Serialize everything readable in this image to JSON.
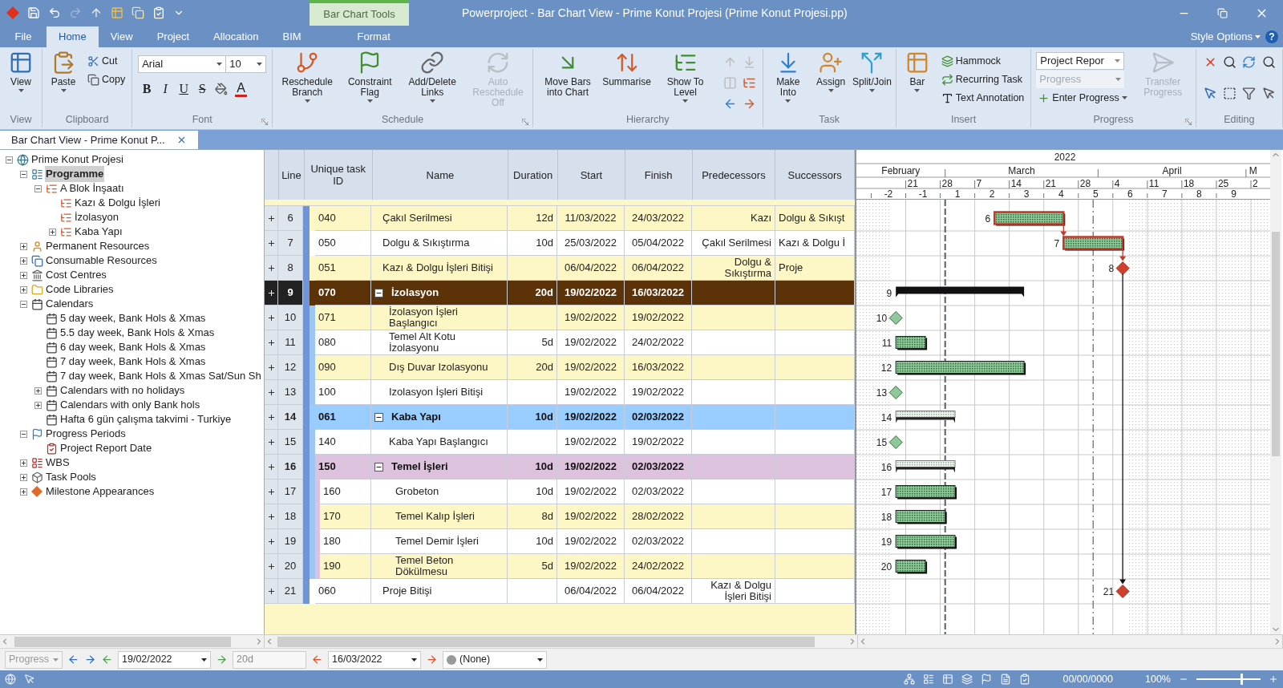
{
  "window": {
    "title": "Powerproject - Bar Chart View - Prime Konut Projesi (Prime Konut Projesi.pp)",
    "context_tab_group": "Bar Chart Tools"
  },
  "ribbon": {
    "file": "File",
    "style_options": "Style Options",
    "help": "?",
    "tabs": [
      {
        "label": "Home",
        "selected": true
      },
      {
        "label": "View",
        "selected": false
      },
      {
        "label": "Project",
        "selected": false
      },
      {
        "label": "Allocation",
        "selected": false
      },
      {
        "label": "BIM",
        "selected": false
      },
      {
        "label": "Format",
        "selected": false
      }
    ],
    "groups": [
      {
        "label": "View",
        "launcher": false,
        "items": [
          {
            "kind": "large",
            "label": "View",
            "dropdown": true,
            "disabled": false
          }
        ]
      },
      {
        "label": "Clipboard",
        "launcher": false,
        "items": [
          {
            "kind": "large",
            "label": "Paste",
            "dropdown": true,
            "disabled": false
          },
          {
            "kind": "small",
            "label": "Cut",
            "dropdown": false,
            "disabled": false
          },
          {
            "kind": "small",
            "label": "Copy",
            "dropdown": false,
            "disabled": false
          }
        ]
      },
      {
        "label": "Font",
        "launcher": true,
        "items": [
          {
            "kind": "font",
            "font": "Arial",
            "size": "10",
            "styles": [
              "B",
              "I",
              "U",
              "S"
            ],
            "color_letter": "A"
          }
        ]
      },
      {
        "label": "Schedule",
        "launcher": true,
        "items": [
          {
            "kind": "large",
            "label": "Reschedule Branch",
            "dropdown": true,
            "disabled": false
          },
          {
            "kind": "large",
            "label": "Constraint Flag",
            "dropdown": true,
            "disabled": false
          },
          {
            "kind": "large",
            "label": "Add/Delete Links",
            "dropdown": true,
            "disabled": false
          },
          {
            "kind": "large",
            "label": "Auto Reschedule Off",
            "dropdown": false,
            "disabled": true
          }
        ]
      },
      {
        "label": "Hierarchy",
        "launcher": false,
        "items": [
          {
            "kind": "large",
            "label": "Move Bars into Chart",
            "dropdown": false,
            "disabled": false
          },
          {
            "kind": "large",
            "label": "Summarise",
            "dropdown": false,
            "disabled": false
          },
          {
            "kind": "large",
            "label": "Show To Level",
            "dropdown": true,
            "disabled": false
          },
          {
            "kind": "icon_grid"
          }
        ]
      },
      {
        "label": "Task",
        "launcher": false,
        "items": [
          {
            "kind": "large",
            "label": "Make Into",
            "dropdown": true,
            "disabled": false
          },
          {
            "kind": "large",
            "label": "Assign",
            "dropdown": true,
            "disabled": false
          },
          {
            "kind": "large",
            "label": "Split/Join",
            "dropdown": true,
            "disabled": false
          }
        ]
      },
      {
        "label": "Insert",
        "launcher": false,
        "items": [
          {
            "kind": "large",
            "label": "Bar",
            "dropdown": true,
            "disabled": false
          },
          {
            "kind": "small",
            "label": "Hammock",
            "dropdown": false,
            "disabled": false
          },
          {
            "kind": "small",
            "label": "Recurring Task",
            "dropdown": false,
            "disabled": false
          },
          {
            "kind": "small",
            "label": "Text Annotation",
            "dropdown": false,
            "disabled": false
          }
        ]
      },
      {
        "label": "Progress",
        "launcher": true,
        "items": [
          {
            "kind": "combo",
            "value": "Project Repor",
            "disabled": false
          },
          {
            "kind": "combo",
            "value": "Progress",
            "disabled": true
          },
          {
            "kind": "small",
            "label": "Enter Progress",
            "dropdown": true,
            "disabled": false
          },
          {
            "kind": "large",
            "label": "Transfer Progress",
            "dropdown": false,
            "disabled": true
          }
        ]
      },
      {
        "label": "Editing",
        "launcher": false,
        "items": [
          {
            "kind": "icon_grid"
          }
        ]
      }
    ]
  },
  "document_tab": {
    "label": "Bar Chart View - Prime Konut P...",
    "selected": true
  },
  "tree": [
    {
      "label": "Prime Konut Projesi",
      "kind": "project",
      "expanded": true,
      "selected": false,
      "children": [
        {
          "label": "Programme",
          "kind": "programme",
          "expanded": true,
          "selected": true,
          "children": [
            {
              "label": "A Blok İnşaatı",
              "kind": "chart",
              "expanded": true,
              "selected": false,
              "children": [
                {
                  "label": "Kazı & Dolgu İşleri",
                  "kind": "chart",
                  "selected": false
                },
                {
                  "label": "İzolasyon",
                  "kind": "chart",
                  "selected": false
                },
                {
                  "label": "Kaba Yapı",
                  "kind": "chart",
                  "expanded": false,
                  "selected": false
                }
              ]
            }
          ]
        },
        {
          "label": "Permanent Resources",
          "kind": "resource",
          "expanded": false,
          "selected": false
        },
        {
          "label": "Consumable Resources",
          "kind": "consumable",
          "expanded": false,
          "selected": false
        },
        {
          "label": "Cost Centres",
          "kind": "cost",
          "expanded": false,
          "selected": false
        },
        {
          "label": "Code Libraries",
          "kind": "library",
          "expanded": false,
          "selected": false
        },
        {
          "label": "Calendars",
          "kind": "calendar",
          "expanded": true,
          "selected": false,
          "children": [
            {
              "label": "5 day week, Bank Hols & Xmas",
              "kind": "calendar",
              "selected": false
            },
            {
              "label": "5.5 day week, Bank Hols &  Xmas",
              "kind": "calendar",
              "selected": false
            },
            {
              "label": "6 day week, Bank Hols & Xmas",
              "kind": "calendar",
              "selected": false
            },
            {
              "label": "7 day week, Bank Hols & Xmas",
              "kind": "calendar",
              "selected": false
            },
            {
              "label": "7 day week, Bank Hols & Xmas Sat/Sun Sh",
              "kind": "calendar",
              "selected": false
            },
            {
              "label": "Calendars with no holidays",
              "kind": "calendar",
              "expanded": false,
              "selected": false
            },
            {
              "label": "Calendars with only Bank hols",
              "kind": "calendar",
              "expanded": false,
              "selected": false
            },
            {
              "label": "Hafta 6 gün çalışma takvimi - Turkiye",
              "kind": "calendar",
              "selected": false
            }
          ]
        },
        {
          "label": "Progress Periods",
          "kind": "progress",
          "expanded": true,
          "selected": false,
          "children": [
            {
              "label": "Project Report Date",
              "kind": "report",
              "selected": false
            }
          ]
        },
        {
          "label": "WBS",
          "kind": "wbs",
          "expanded": false,
          "selected": false
        },
        {
          "label": "Task Pools",
          "kind": "pool",
          "expanded": false,
          "selected": false
        },
        {
          "label": "Milestone Appearances",
          "kind": "milestone",
          "expanded": false,
          "selected": false
        }
      ]
    }
  ],
  "table": {
    "columns": [
      "Line",
      "Unique task ID",
      "Name",
      "Duration",
      "Start",
      "Finish",
      "Predecessors",
      "Successors"
    ],
    "rows": [
      {
        "line": "6",
        "id": "040",
        "name": "Çakıl Serilmesi",
        "duration": "12d",
        "start": "11/03/2022",
        "finish": "24/03/2022",
        "predecessors": "Kazı",
        "successors": "Dolgu & Sıkışt",
        "kind": "task",
        "selected": false,
        "bar": {
          "kind": "task",
          "critical": true,
          "label": "6"
        }
      },
      {
        "line": "7",
        "id": "050",
        "name": "Dolgu & Sıkıştırma",
        "duration": "10d",
        "start": "25/03/2022",
        "finish": "05/04/2022",
        "predecessors": "Çakıl Serilmesi",
        "successors": "Kazı & Dolgu İ",
        "kind": "task",
        "selected": false,
        "bar": {
          "kind": "task",
          "critical": true,
          "label": "7"
        }
      },
      {
        "line": "8",
        "id": "051",
        "name": "Kazı & Dolgu İşleri Bitişi",
        "start": "06/04/2022",
        "finish": "06/04/2022",
        "predecessors": "Dolgu & Sıkıştırma",
        "successors": "Proje",
        "kind": "task",
        "selected": false,
        "bar": {
          "kind": "milestone",
          "critical": true,
          "label": "8"
        }
      },
      {
        "line": "9",
        "id": "070",
        "name": "İzolasyon",
        "duration": "20d",
        "start": "19/02/2022",
        "finish": "16/03/2022",
        "kind": "summary",
        "color": "#5c3208",
        "expanded": true,
        "selected": true,
        "bar": {
          "kind": "summary",
          "critical": false,
          "label": "9"
        },
        "children": [
          {
            "line": "10",
            "id": "071",
            "name": "İzolasyon İşleri Başlangıcı",
            "start": "19/02/2022",
            "finish": "19/02/2022",
            "kind": "task",
            "selected": false,
            "bar": {
              "kind": "milestone",
              "critical": false,
              "label": "10"
            }
          },
          {
            "line": "11",
            "id": "080",
            "name": "Temel Alt Kotu İzolasyonu",
            "duration": "5d",
            "start": "19/02/2022",
            "finish": "24/02/2022",
            "kind": "task",
            "selected": false,
            "bar": {
              "kind": "task",
              "critical": false,
              "label": "11"
            }
          },
          {
            "line": "12",
            "id": "090",
            "name": "Dış Duvar Izolasyonu",
            "duration": "20d",
            "start": "19/02/2022",
            "finish": "16/03/2022",
            "kind": "task",
            "selected": false,
            "bar": {
              "kind": "task",
              "critical": false,
              "label": "12"
            }
          },
          {
            "line": "13",
            "id": "100",
            "name": "Izolasyon İşleri Bitişi",
            "start": "19/02/2022",
            "finish": "19/02/2022",
            "kind": "task",
            "selected": false,
            "bar": {
              "kind": "milestone",
              "critical": false,
              "label": "13"
            }
          }
        ]
      },
      {
        "line": "14",
        "id": "061",
        "name": "Kaba Yapı",
        "duration": "10d",
        "start": "19/02/2022",
        "finish": "02/03/2022",
        "kind": "summary",
        "color": "#99ccff",
        "expanded": true,
        "selected": false,
        "bar": {
          "kind": "rollup",
          "critical": false,
          "label": "14"
        },
        "children": [
          {
            "line": "15",
            "id": "140",
            "name": "Kaba Yapı Başlangıcı",
            "start": "19/02/2022",
            "finish": "19/02/2022",
            "kind": "task",
            "selected": false,
            "bar": {
              "kind": "milestone",
              "critical": false,
              "label": "15"
            }
          },
          {
            "line": "16",
            "id": "150",
            "name": "Temel İşleri",
            "duration": "10d",
            "start": "19/02/2022",
            "finish": "02/03/2022",
            "kind": "summary",
            "color": "#dcc2dc",
            "expanded": true,
            "selected": false,
            "bar": {
              "kind": "rollup",
              "critical": false,
              "label": "16"
            },
            "children": [
              {
                "line": "17",
                "id": "160",
                "name": "Grobeton",
                "duration": "10d",
                "start": "19/02/2022",
                "finish": "02/03/2022",
                "kind": "task",
                "selected": false,
                "bar": {
                  "kind": "task",
                  "critical": false,
                  "label": "17"
                }
              },
              {
                "line": "18",
                "id": "170",
                "name": "Temel Kalıp İşleri",
                "duration": "8d",
                "start": "19/02/2022",
                "finish": "28/02/2022",
                "kind": "task",
                "selected": false,
                "bar": {
                  "kind": "task",
                  "critical": false,
                  "label": "18"
                }
              },
              {
                "line": "19",
                "id": "180",
                "name": "Temel Demir İşleri",
                "duration": "10d",
                "start": "19/02/2022",
                "finish": "02/03/2022",
                "kind": "task",
                "selected": false,
                "bar": {
                  "kind": "task",
                  "critical": false,
                  "label": "19"
                }
              },
              {
                "line": "20",
                "id": "190",
                "name": "Temel Beton Dökülmesu",
                "duration": "5d",
                "start": "19/02/2022",
                "finish": "24/02/2022",
                "kind": "task",
                "selected": false,
                "bar": {
                  "kind": "task",
                  "critical": false,
                  "label": "20"
                }
              }
            ]
          }
        ]
      },
      {
        "line": "21",
        "id": "060",
        "name": "Proje Bitişi",
        "start": "06/04/2022",
        "finish": "06/04/2022",
        "predecessors": "Kazı & Dolgu İşleri Bitişi",
        "kind": "task",
        "selected": false,
        "bar": {
          "kind": "milestone",
          "critical": true,
          "label": "21"
        }
      }
    ]
  },
  "gantt": {
    "year": "2022",
    "months": [
      "February",
      "March",
      "April",
      "M"
    ],
    "days": [
      "21",
      "28",
      "7",
      "14",
      "21",
      "28",
      "4",
      "11",
      "18",
      "25",
      "2"
    ],
    "weeks": [
      "-2",
      "-1",
      "1",
      "2",
      "3",
      "4",
      "5",
      "6",
      "7",
      "8",
      "9"
    ]
  },
  "bottom_toolbar": {
    "progress": {
      "value": "Progress",
      "disabled": true
    },
    "start_date": "19/02/2022",
    "duration": {
      "value": "20d",
      "disabled": true
    },
    "finish_date": "16/03/2022",
    "style": "(None)"
  },
  "status_bar": {
    "date": "00/00/0000",
    "zoom": "100%",
    "zoom_slider": {
      "level": 0.72
    }
  }
}
